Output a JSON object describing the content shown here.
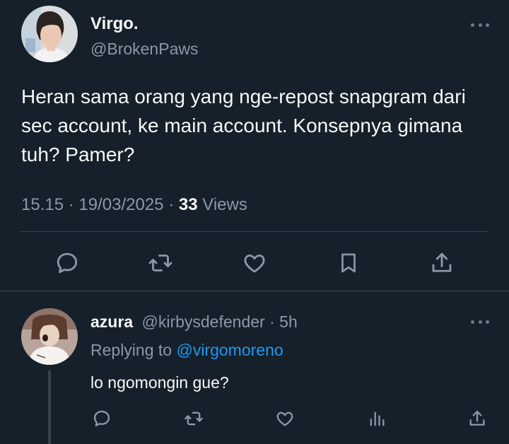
{
  "tweet": {
    "author": {
      "display_name": "Virgo.",
      "handle": "@BrokenPaws",
      "avatar_icon": "profile-photo"
    },
    "text": "Heran sama orang yang nge-repost snapgram dari sec account, ke main account. Konsepnya gimana tuh? Pamer?",
    "time": "15.15",
    "date": "19/03/2025",
    "separator": "·",
    "views_count": "33",
    "views_label": "Views",
    "actions": [
      "reply-icon",
      "retweet-icon",
      "like-icon",
      "bookmark-icon",
      "share-icon"
    ]
  },
  "reply": {
    "display_name": "azura",
    "handle": "@kirbysdefender",
    "separator": "·",
    "age": "5h",
    "replying_label": "Replying to",
    "replying_to": "@virgomoreno",
    "text": "lo ngomongin gue?",
    "actions": [
      "reply-icon",
      "retweet-icon",
      "like-icon",
      "views-icon",
      "share-icon"
    ]
  },
  "colors": {
    "background": "#15202b",
    "primary_text": "#f7f9f9",
    "secondary_text": "#8b98a5",
    "accent": "#1d9bf0",
    "divider": "#38444d"
  }
}
